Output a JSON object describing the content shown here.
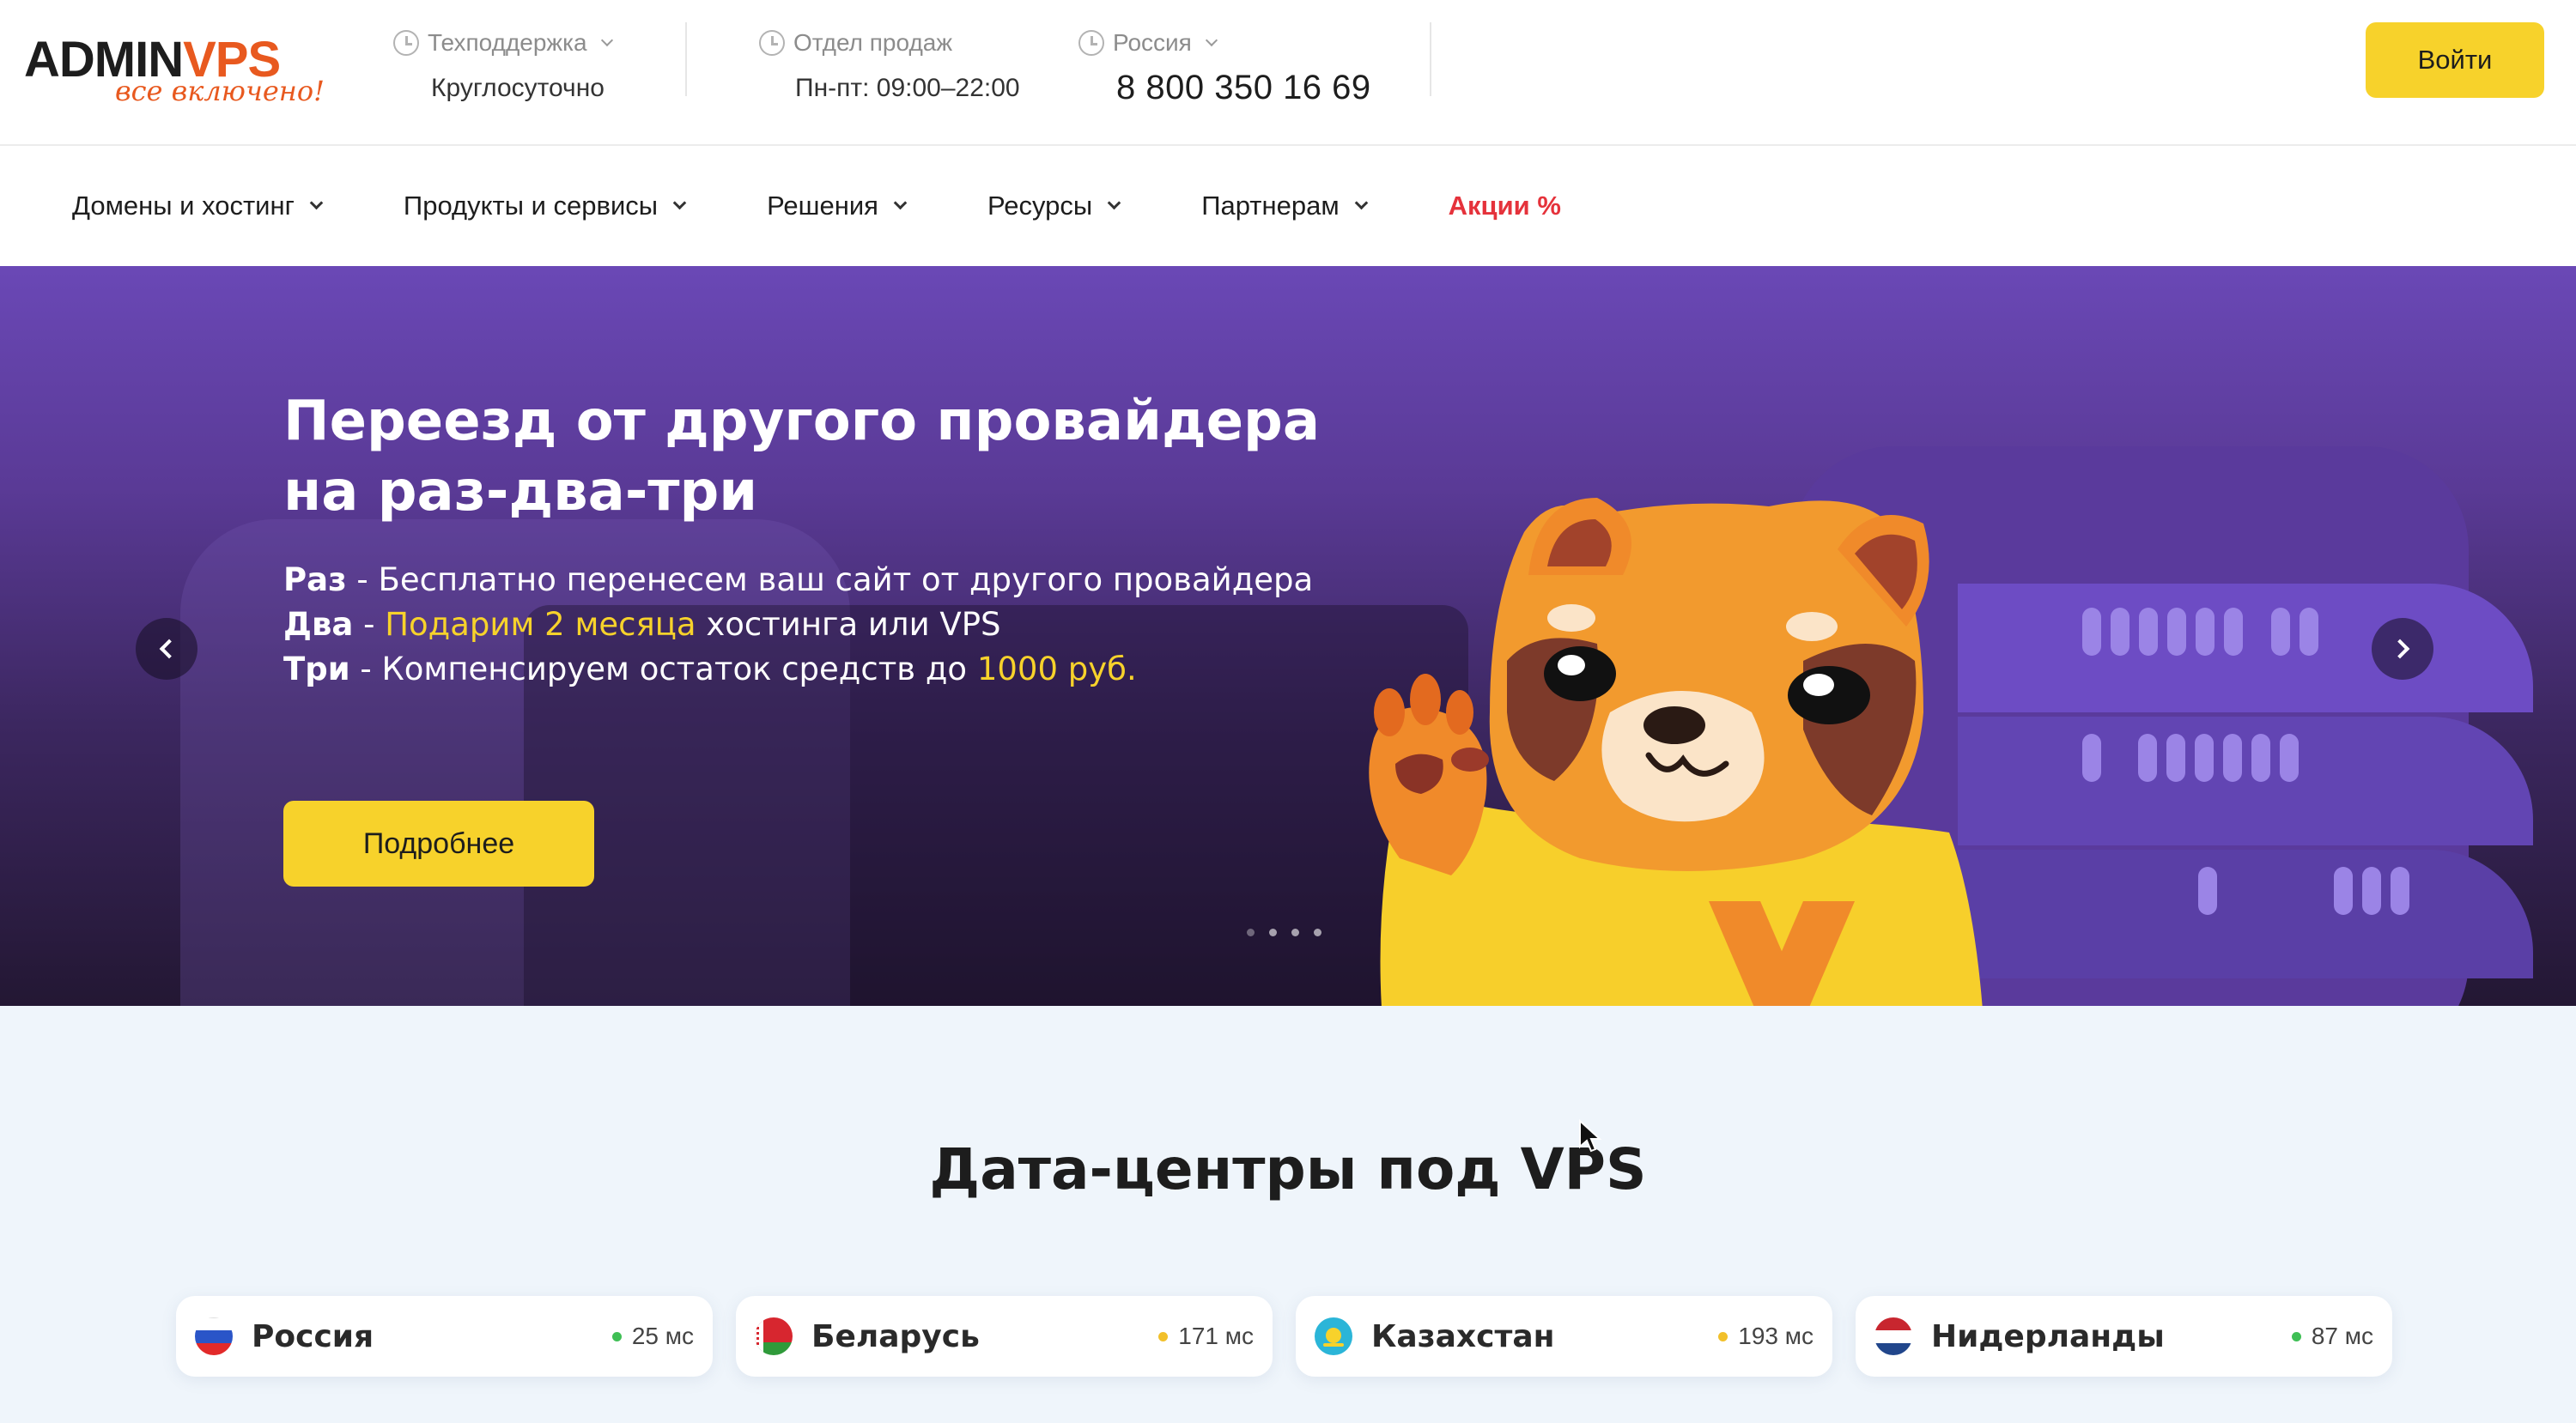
{
  "header": {
    "logo": {
      "text_main": "ADMIN",
      "text_accent": "VPS",
      "tagline": "все включено!"
    },
    "support": {
      "label": "Техподдержка",
      "value": "Круглосуточно"
    },
    "sales": {
      "label": "Отдел продаж",
      "value": "Пн-пт: 09:00–22:00"
    },
    "region": {
      "label": "Россия",
      "phone": "8 800 350 16 69"
    },
    "login_label": "Войти"
  },
  "nav": {
    "items": [
      {
        "label": "Домены и хостинг"
      },
      {
        "label": "Продукты и сервисы"
      },
      {
        "label": "Решения"
      },
      {
        "label": "Ресурсы"
      },
      {
        "label": "Партнерам"
      }
    ],
    "promo": "Акции %"
  },
  "hero": {
    "title_line1": "Переезд от другого провайдера",
    "title_line2": "на раз-два-три",
    "line1": {
      "label": "Раз",
      "text": " - Бесплатно перенесем ваш сайт от другого провайдера"
    },
    "line2": {
      "label": "Два",
      "dash": " - ",
      "highlight": "Подарим 2 месяца",
      "text": " хостинга или VPS"
    },
    "line3": {
      "label": "Три",
      "text": " - Компенсируем остаток средств до ",
      "highlight": "1000 руб."
    },
    "cta": "Подробнее",
    "slides": {
      "count": 4,
      "active": 1
    }
  },
  "datacenters": {
    "title": "Дата-центры под VPS",
    "items": [
      {
        "name": "Россия",
        "ping": "25 мс",
        "status_color": "#3fbf55"
      },
      {
        "name": "Беларусь",
        "ping": "171 мс",
        "status_color": "#f2c02a"
      },
      {
        "name": "Казахстан",
        "ping": "193 мс",
        "status_color": "#f2c02a"
      },
      {
        "name": "Нидерланды",
        "ping": "87 мс",
        "status_color": "#3fbf55"
      }
    ]
  },
  "colors": {
    "brand_orange": "#e8591f",
    "accent_yellow": "#f7d22b",
    "promo_red": "#e5323b",
    "hero_purple": "#6a48b6"
  }
}
